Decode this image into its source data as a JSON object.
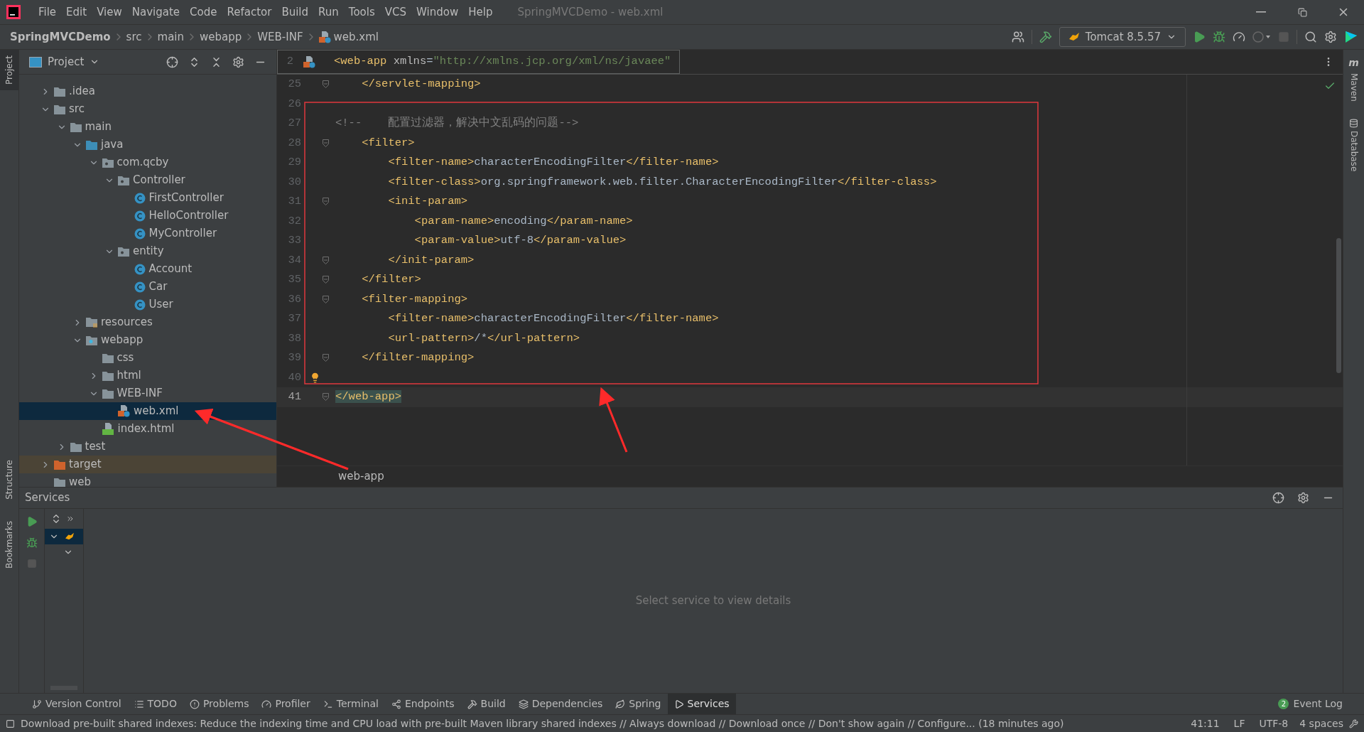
{
  "window": {
    "title": "SpringMVCDemo - web.xml"
  },
  "menu": [
    "File",
    "Edit",
    "View",
    "Navigate",
    "Code",
    "Refactor",
    "Build",
    "Run",
    "Tools",
    "VCS",
    "Window",
    "Help"
  ],
  "breadcrumbs": [
    "SpringMVCDemo",
    "src",
    "main",
    "webapp",
    "WEB-INF",
    "web.xml"
  ],
  "run_config": {
    "label": "Tomcat 8.5.57"
  },
  "left_stripe": [
    "Project",
    "Structure",
    "Bookmarks"
  ],
  "maven_badge": "m",
  "right_stripe": [
    "Maven",
    "Database"
  ],
  "project": {
    "title": "Project",
    "tree": [
      {
        "label": ".idea",
        "kind": "folder",
        "expanded": false,
        "selected": false
      },
      {
        "label": "src",
        "kind": "folder",
        "expanded": true,
        "selected": false,
        "children": [
          {
            "label": "main",
            "kind": "folder",
            "expanded": true,
            "selected": false,
            "children": [
              {
                "label": "java",
                "kind": "source",
                "expanded": true,
                "selected": false,
                "children": [
                  {
                    "label": "com.qcby",
                    "kind": "package",
                    "expanded": true,
                    "selected": false,
                    "children": [
                      {
                        "label": "Controller",
                        "kind": "package",
                        "expanded": true,
                        "selected": false,
                        "children": [
                          {
                            "label": "FirstController",
                            "kind": "class",
                            "selected": false
                          },
                          {
                            "label": "HelloController",
                            "kind": "class",
                            "selected": false
                          },
                          {
                            "label": "MyController",
                            "kind": "class",
                            "selected": false
                          }
                        ]
                      },
                      {
                        "label": "entity",
                        "kind": "package",
                        "expanded": true,
                        "selected": false,
                        "children": [
                          {
                            "label": "Account",
                            "kind": "class",
                            "selected": false
                          },
                          {
                            "label": "Car",
                            "kind": "class",
                            "selected": false
                          },
                          {
                            "label": "User",
                            "kind": "class",
                            "selected": false
                          }
                        ]
                      }
                    ]
                  }
                ]
              },
              {
                "label": "resources",
                "kind": "resources",
                "expanded": false,
                "selected": false
              },
              {
                "label": "webapp",
                "kind": "web",
                "expanded": true,
                "selected": false,
                "children": [
                  {
                    "label": "css",
                    "kind": "folder",
                    "selected": false
                  },
                  {
                    "label": "html",
                    "kind": "folder",
                    "expanded": false,
                    "selected": false
                  },
                  {
                    "label": "WEB-INF",
                    "kind": "folder",
                    "expanded": true,
                    "selected": false,
                    "children": [
                      {
                        "label": "web.xml",
                        "kind": "xml",
                        "selected": true
                      }
                    ]
                  },
                  {
                    "label": "index.html",
                    "kind": "html",
                    "selected": false
                  }
                ]
              }
            ]
          },
          {
            "label": "test",
            "kind": "folder",
            "expanded": false,
            "selected": false
          }
        ]
      },
      {
        "label": "target",
        "kind": "excluded",
        "expanded": false,
        "selected": false
      },
      {
        "label": "web",
        "kind": "folder",
        "selected": false
      }
    ]
  },
  "editor": {
    "sticky_line": {
      "number": "2",
      "segments": [
        {
          "kind": "tag",
          "text": "<web-app "
        },
        {
          "kind": "attr",
          "text": "xmlns"
        },
        {
          "kind": "text",
          "text": "="
        },
        {
          "kind": "value",
          "text": "\"http://xmlns.jcp.org/xml/ns/javaee\""
        }
      ]
    },
    "lines": [
      {
        "number": "25",
        "fold": true,
        "current": false,
        "bulb": false,
        "segments": [
          {
            "kind": "tag",
            "text": "    </servlet-mapping>"
          }
        ]
      },
      {
        "number": "26",
        "fold": false,
        "current": false,
        "bulb": false
      },
      {
        "number": "27",
        "fold": false,
        "current": false,
        "bulb": false,
        "segments": [
          {
            "kind": "comment",
            "text": "<!--    配置过滤器，解决中文乱码的问题-->"
          }
        ]
      },
      {
        "number": "28",
        "fold": true,
        "current": false,
        "bulb": false,
        "segments": [
          {
            "kind": "tag",
            "text": "    <filter>"
          }
        ]
      },
      {
        "number": "29",
        "fold": false,
        "current": false,
        "bulb": false,
        "segments": [
          {
            "kind": "tag",
            "text": "        <filter-name>"
          },
          {
            "kind": "text",
            "text": "characterEncodingFilter"
          },
          {
            "kind": "tag",
            "text": "</filter-name>"
          }
        ]
      },
      {
        "number": "30",
        "fold": false,
        "current": false,
        "bulb": false,
        "segments": [
          {
            "kind": "tag",
            "text": "        <filter-class>"
          },
          {
            "kind": "text",
            "text": "org.springframework.web.filter.CharacterEncodingFilter"
          },
          {
            "kind": "tag",
            "text": "</filter-class>"
          }
        ]
      },
      {
        "number": "31",
        "fold": true,
        "current": false,
        "bulb": false,
        "segments": [
          {
            "kind": "tag",
            "text": "        <init-param>"
          }
        ]
      },
      {
        "number": "32",
        "fold": false,
        "current": false,
        "bulb": false,
        "segments": [
          {
            "kind": "tag",
            "text": "            <param-name>"
          },
          {
            "kind": "text",
            "text": "encoding"
          },
          {
            "kind": "tag",
            "text": "</param-name>"
          }
        ]
      },
      {
        "number": "33",
        "fold": false,
        "current": false,
        "bulb": false,
        "segments": [
          {
            "kind": "tag",
            "text": "            <param-value>"
          },
          {
            "kind": "text",
            "text": "utf-8"
          },
          {
            "kind": "tag",
            "text": "</param-value>"
          }
        ]
      },
      {
        "number": "34",
        "fold": true,
        "current": false,
        "bulb": false,
        "segments": [
          {
            "kind": "tag",
            "text": "        </init-param>"
          }
        ]
      },
      {
        "number": "35",
        "fold": true,
        "current": false,
        "bulb": false,
        "segments": [
          {
            "kind": "tag",
            "text": "    </filter>"
          }
        ]
      },
      {
        "number": "36",
        "fold": true,
        "current": false,
        "bulb": false,
        "segments": [
          {
            "kind": "tag",
            "text": "    <filter-mapping>"
          }
        ]
      },
      {
        "number": "37",
        "fold": false,
        "current": false,
        "bulb": false,
        "segments": [
          {
            "kind": "tag",
            "text": "        <filter-name>"
          },
          {
            "kind": "text",
            "text": "characterEncodingFilter"
          },
          {
            "kind": "tag",
            "text": "</filter-name>"
          }
        ]
      },
      {
        "number": "38",
        "fold": false,
        "current": false,
        "bulb": false,
        "segments": [
          {
            "kind": "tag",
            "text": "        <url-pattern>"
          },
          {
            "kind": "text",
            "text": "/*"
          },
          {
            "kind": "tag",
            "text": "</url-pattern>"
          }
        ]
      },
      {
        "number": "39",
        "fold": true,
        "current": false,
        "bulb": false,
        "segments": [
          {
            "kind": "tag",
            "text": "    </filter-mapping>"
          }
        ]
      },
      {
        "number": "40",
        "fold": false,
        "current": false,
        "bulb": true
      },
      {
        "number": "41",
        "fold": true,
        "current": true,
        "bulb": false,
        "segments": [
          {
            "kind": "match",
            "text": "</web-app>"
          }
        ]
      }
    ],
    "breadcrumb": "web-app"
  },
  "services": {
    "title": "Services",
    "empty_message": "Select service to view details"
  },
  "tool_tabs": [
    {
      "label": "Version Control",
      "selected": false
    },
    {
      "label": "TODO",
      "selected": false
    },
    {
      "label": "Problems",
      "selected": false
    },
    {
      "label": "Profiler",
      "selected": false
    },
    {
      "label": "Terminal",
      "selected": false
    },
    {
      "label": "Endpoints",
      "selected": false
    },
    {
      "label": "Build",
      "selected": false
    },
    {
      "label": "Dependencies",
      "selected": false
    },
    {
      "label": "Spring",
      "selected": false
    },
    {
      "label": "Services",
      "selected": true
    }
  ],
  "event_log": {
    "label": "Event Log",
    "count": "2"
  },
  "status_bar": {
    "message": "Download pre-built shared indexes: Reduce the indexing time and CPU load with pre-built Maven library shared indexes // Always download // Download once // Don't show again // Configure... (18 minutes ago)",
    "position": "41:11",
    "line_separator": "LF",
    "encoding": "UTF-8",
    "indent": "4 spaces"
  }
}
